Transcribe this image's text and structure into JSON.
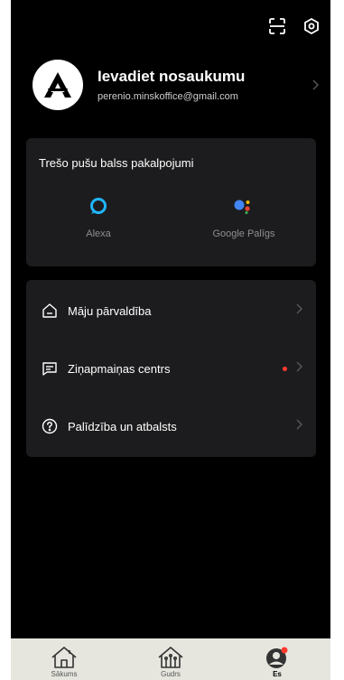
{
  "profile": {
    "name": "Ievadiet nosaukumu",
    "email": "perenio.minskoffice@gmail.com"
  },
  "voice_services": {
    "title": "Trešo pušu balss pakalpojumi",
    "items": [
      {
        "label": "Alexa",
        "icon": "alexa-icon"
      },
      {
        "label": "Google Palīgs",
        "icon": "google-assistant-icon"
      }
    ]
  },
  "menu": {
    "items": [
      {
        "label": "Māju pārvaldība",
        "icon": "house-icon"
      },
      {
        "label": "Ziņapmaiņas centrs",
        "icon": "message-icon",
        "has_notification": true
      },
      {
        "label": "Palīdzība un atbalsts",
        "icon": "help-icon"
      }
    ]
  },
  "tabs": [
    {
      "label": "Sākums",
      "icon": "home-icon"
    },
    {
      "label": "Gudrs",
      "icon": "smart-home-icon"
    },
    {
      "label": "Es",
      "icon": "profile-icon",
      "active": true
    }
  ],
  "colors": {
    "background": "#000000",
    "card": "#1c1c1e",
    "notification_dot": "#ff3b30",
    "alexa": "#1fb6ff",
    "tabbar": "#e6e6df"
  }
}
